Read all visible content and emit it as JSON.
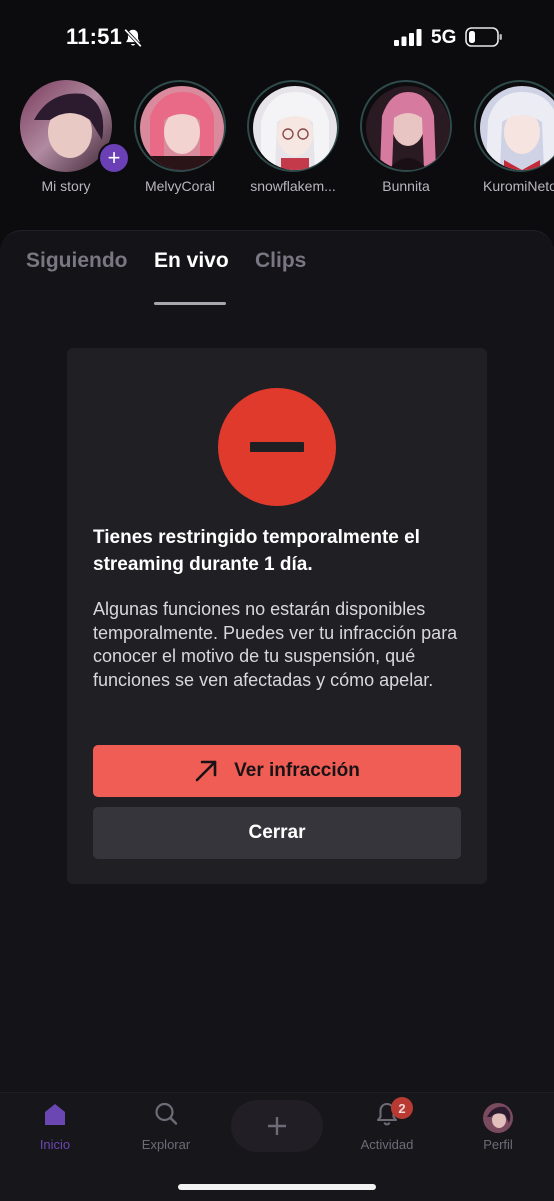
{
  "status_bar": {
    "time": "11:51",
    "network": "5G",
    "icons": [
      "bell-slash-icon",
      "signal-icon",
      "battery-icon"
    ]
  },
  "stories": [
    {
      "name": "Mi story",
      "add_label": "+"
    },
    {
      "name": "MelvyCoral"
    },
    {
      "name": "snowflakem..."
    },
    {
      "name": "Bunnita"
    },
    {
      "name": "KuromiNeto"
    }
  ],
  "tabs": [
    {
      "label": "Siguiendo",
      "active": false
    },
    {
      "label": "En vivo",
      "active": true
    },
    {
      "label": "Clips",
      "active": false
    }
  ],
  "dialog": {
    "title": "Tienes restringido temporalmente el streaming durante 1 día.",
    "body": "Algunas funciones no estarán disponibles temporalmente. Puedes ver tu infracción para conocer el motivo de tu suspensión, qué funciones se ven afectadas y cómo apelar.",
    "primary_button": "Ver infracción",
    "secondary_button": "Cerrar"
  },
  "nav": {
    "items": [
      {
        "label": "Inicio",
        "icon": "home-icon",
        "active": true
      },
      {
        "label": "Explorar",
        "icon": "search-icon"
      },
      {
        "label": "Actividad",
        "icon": "bell-icon",
        "badge": "2"
      },
      {
        "label": "Perfil",
        "icon": "avatar"
      }
    ],
    "create_label": "+"
  },
  "colors": {
    "accent": "#6a47b3",
    "danger": "#e03a2d",
    "primary_button": "#ef5d55"
  }
}
